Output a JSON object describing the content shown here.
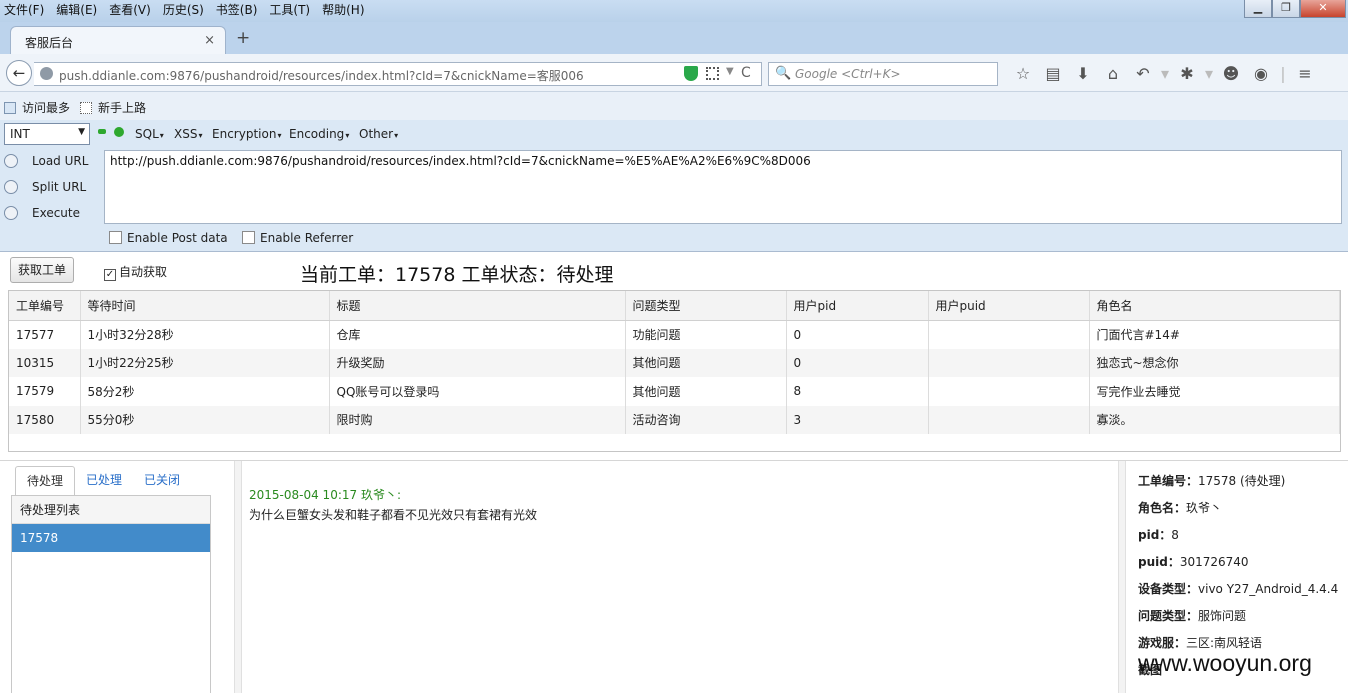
{
  "menu": [
    "文件(F)",
    "编辑(E)",
    "查看(V)",
    "历史(S)",
    "书签(B)",
    "工具(T)",
    "帮助(H)"
  ],
  "window_controls": {
    "minimize": "▁",
    "maximize": "❐",
    "close": "✕"
  },
  "tab": {
    "title": "客服后台",
    "close": "×",
    "new_tab": "+"
  },
  "nav": {
    "back": "←",
    "url": "push.ddianle.com:9876/pushandroid/resources/index.html?cId=7&cnickName=客服006",
    "reload": "C",
    "search_placeholder": "Google <Ctrl+K>",
    "icons": [
      "star-icon",
      "reading-list-icon",
      "download-icon",
      "home-icon",
      "undo-icon",
      "bug-icon",
      "face-icon",
      "globe-icon",
      "menu-icon"
    ]
  },
  "bookmarks": [
    "访问最多",
    "新手上路"
  ],
  "hackbar": {
    "select": "INT",
    "menus": [
      "SQL",
      "XSS",
      "Encryption",
      "Encoding",
      "Other"
    ],
    "load_url": "Load URL",
    "split_url": "Split URL",
    "execute": "Execute",
    "url_text": "http://push.ddianle.com:9876/pushandroid/resources/index.html?cId=7&cnickName=%E5%AE%A2%E6%9C%8D006",
    "enable_post": "Enable Post data",
    "enable_referrer": "Enable Referrer"
  },
  "toolbar": {
    "fetch_button": "获取工单",
    "auto_fetch": "自动获取",
    "auto_fetch_checked": "✓",
    "current_order": "当前工单：17578 工单状态：待处理"
  },
  "table": {
    "headers": [
      "工单编号",
      "等待时间",
      "标题",
      "问题类型",
      "用户pid",
      "用户puid",
      "角色名"
    ],
    "rows": [
      [
        "17577",
        "1小时32分28秒",
        "仓库",
        "功能问题",
        "0",
        "",
        "门面代言#14#"
      ],
      [
        "10315",
        "1小时22分25秒",
        "升级奖励",
        "其他问题",
        "0",
        "",
        "独恋式~想念你"
      ],
      [
        "17579",
        "58分2秒",
        "QQ账号可以登录吗",
        "其他问题",
        "8",
        "",
        "写完作业去睡觉"
      ],
      [
        "17580",
        "55分0秒",
        "限时购",
        "活动咨询",
        "3",
        "",
        "寡淡。"
      ]
    ]
  },
  "left_panel": {
    "tabs": [
      "待处理",
      "已处理",
      "已关闭"
    ],
    "list_header": "待处理列表",
    "items": [
      "17578"
    ]
  },
  "chat": {
    "meta": "2015-08-04 10:17 玖爷丶:",
    "message": "为什么巨蟹女头发和鞋子都看不见光效只有套裙有光效"
  },
  "detail": [
    {
      "k": "工单编号：",
      "v": "17578 (待处理)"
    },
    {
      "k": "角色名：",
      "v": "玖爷丶"
    },
    {
      "k": "pid：",
      "v": "8"
    },
    {
      "k": "puid：",
      "v": "301726740"
    },
    {
      "k": "设备类型：",
      "v": "vivo Y27_Android_4.4.4"
    },
    {
      "k": "问题类型：",
      "v": "服饰问题"
    },
    {
      "k": "游戏服：",
      "v": "三区:南风轻语"
    },
    {
      "k": "截图",
      "v": ""
    }
  ],
  "watermark": "www.wooyun.org",
  "colors": {
    "accent": "#428bca",
    "chat_meta": "#2a8a1f",
    "link": "#2a6fc9"
  }
}
